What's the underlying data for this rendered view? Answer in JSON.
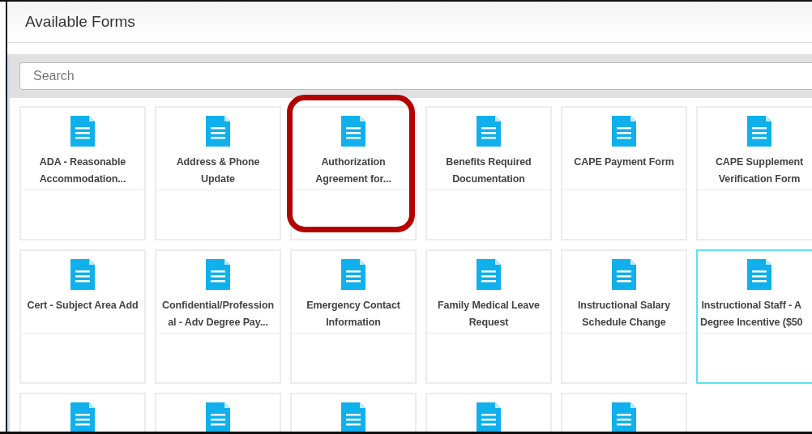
{
  "header": {
    "title": "Available Forms"
  },
  "search": {
    "placeholder": "Search"
  },
  "forms": [
    {
      "lines": [
        "ADA - Reasonable",
        "Accommodation..."
      ],
      "selected": false,
      "highlighted": false
    },
    {
      "lines": [
        "Address & Phone",
        "Update"
      ],
      "selected": false,
      "highlighted": false
    },
    {
      "lines": [
        "Authorization",
        "Agreement for..."
      ],
      "selected": false,
      "highlighted": true
    },
    {
      "lines": [
        "Benefits Required",
        "Documentation"
      ],
      "selected": false,
      "highlighted": false
    },
    {
      "lines": [
        "CAPE Payment Form"
      ],
      "selected": false,
      "highlighted": false
    },
    {
      "lines": [
        "CAPE Supplement",
        "Verification Form"
      ],
      "selected": false,
      "highlighted": false
    },
    {
      "lines": [
        "Cert - Subject Area Add"
      ],
      "selected": false,
      "highlighted": false
    },
    {
      "lines": [
        "Confidential/Profession",
        "al - Adv Degree Pay..."
      ],
      "selected": false,
      "highlighted": false
    },
    {
      "lines": [
        "Emergency Contact",
        "Information"
      ],
      "selected": false,
      "highlighted": false
    },
    {
      "lines": [
        "Family Medical Leave",
        "Request"
      ],
      "selected": false,
      "highlighted": false
    },
    {
      "lines": [
        "Instructional Salary",
        "Schedule Change"
      ],
      "selected": false,
      "highlighted": false
    },
    {
      "lines": [
        "Instructional Staff - A",
        "Degree Incentive ($50"
      ],
      "selected": true,
      "highlighted": false
    },
    {
      "selected": false,
      "highlighted": false
    },
    {
      "selected": false,
      "highlighted": false
    },
    {
      "selected": false,
      "highlighted": false
    },
    {
      "selected": false,
      "highlighted": false
    },
    {
      "selected": false,
      "highlighted": false
    }
  ]
}
